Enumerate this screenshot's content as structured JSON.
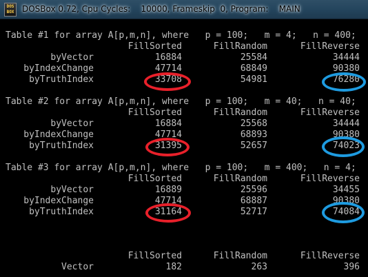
{
  "window": {
    "title": "DOSBox 0.72, Cpu Cycles:    10000, Frameskip  0, Program:    MAIN",
    "icon_text_top": "DOS",
    "icon_text_bottom": "BOX",
    "icon": "dosbox-icon"
  },
  "columns": [
    "FillSorted",
    "FillRandom",
    "FillReverse"
  ],
  "tables": [
    {
      "header": "Table #1 for array A[p,m,n], where   p = 100;   m = 4;   n = 400;",
      "rows": [
        {
          "label": "byVector",
          "values": [
            "16884",
            "25584",
            "34444"
          ]
        },
        {
          "label": "byIndexChange",
          "values": [
            "47714",
            "68849",
            "90380"
          ]
        },
        {
          "label": "byTruthIndex",
          "values": [
            "33708",
            "54981",
            "76280"
          ]
        }
      ]
    },
    {
      "header": "Table #2 for array A[p,m,n], where   p = 100;   m = 40;   n = 40;",
      "rows": [
        {
          "label": "byVector",
          "values": [
            "16884",
            "25568",
            "34444"
          ]
        },
        {
          "label": "byIndexChange",
          "values": [
            "47714",
            "68893",
            "90380"
          ]
        },
        {
          "label": "byTruthIndex",
          "values": [
            "31395",
            "52657",
            "74023"
          ]
        }
      ]
    },
    {
      "header": "Table #3 for array A[p,m,n], where   p = 100;   m = 400;   n = 4;",
      "rows": [
        {
          "label": "byVector",
          "values": [
            "16889",
            "25596",
            "34455"
          ]
        },
        {
          "label": "byIndexChange",
          "values": [
            "47714",
            "68887",
            "90380"
          ]
        },
        {
          "label": "byTruthIndex",
          "values": [
            "31164",
            "52717",
            "74084"
          ]
        }
      ]
    }
  ],
  "summary": {
    "rows": [
      {
        "label": "Vector",
        "values": [
          "182",
          "263",
          "396"
        ]
      }
    ]
  },
  "colors": {
    "highlight_red": "#e8202a",
    "highlight_blue": "#1e9be0",
    "text": "#c0c0c0",
    "background": "#000000"
  }
}
